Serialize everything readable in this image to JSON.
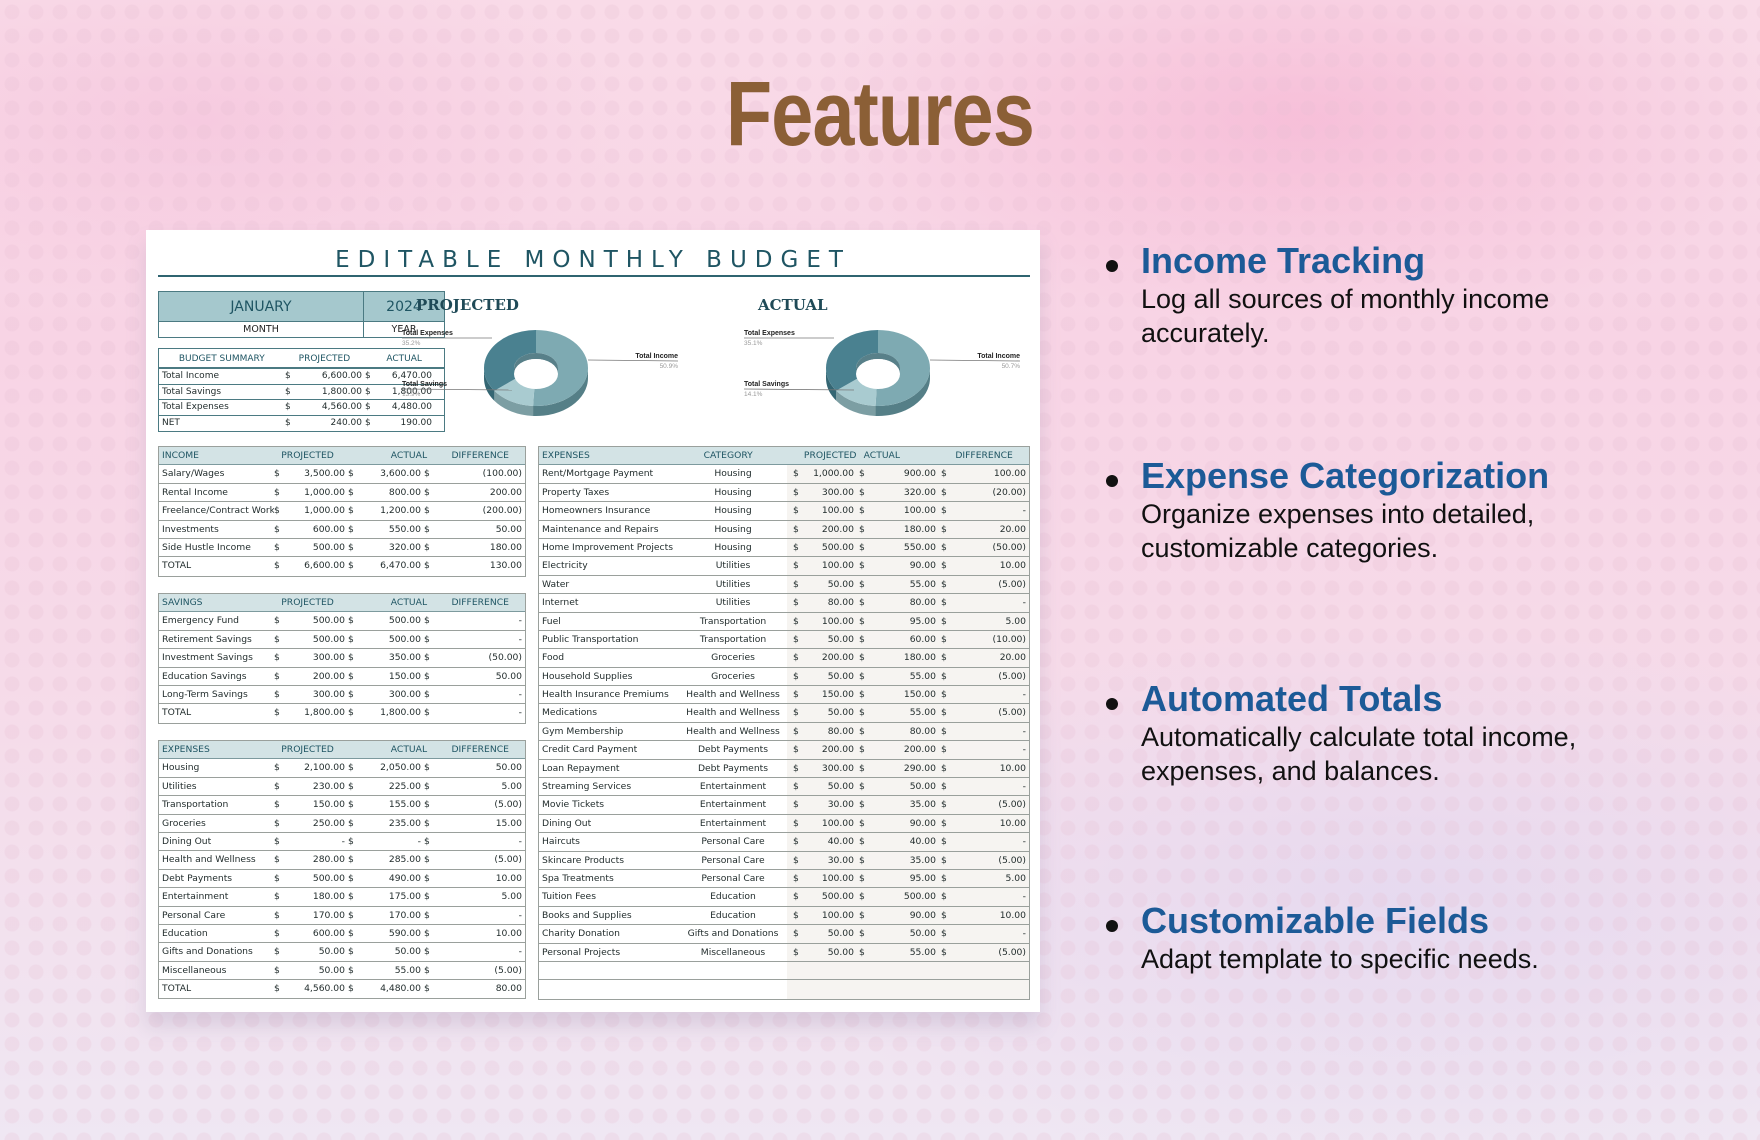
{
  "page": {
    "heading": "Features",
    "colors": {
      "heading": "#8b5f36",
      "feature_title": "#1c5a97",
      "sheet_accent": "#1f5563",
      "header_fill": "#a5c8cd"
    }
  },
  "sheet": {
    "title": "EDITABLE MONTHLY BUDGET",
    "month": {
      "value": "JANUARY",
      "label": "MONTH"
    },
    "year": {
      "value": "2024",
      "label": "YEAR"
    },
    "summary": {
      "headers": [
        "BUDGET SUMMARY",
        "PROJECTED",
        "ACTUAL"
      ],
      "rows": [
        {
          "label": "Total Income",
          "projected": "6,600.00",
          "actual": "6,470.00"
        },
        {
          "label": "Total Savings",
          "projected": "1,800.00",
          "actual": "1,800.00"
        },
        {
          "label": "Total Expenses",
          "projected": "4,560.00",
          "actual": "4,480.00"
        },
        {
          "label": "NET",
          "projected": "240.00",
          "actual": "190.00"
        }
      ]
    },
    "currency": "$",
    "income": {
      "headers": [
        "INCOME",
        "PROJECTED",
        "ACTUAL",
        "DIFFERENCE"
      ],
      "rows": [
        {
          "name": "Salary/Wages",
          "projected": "3,500.00",
          "actual": "3,600.00",
          "difference": "(100.00)"
        },
        {
          "name": "Rental Income",
          "projected": "1,000.00",
          "actual": "800.00",
          "difference": "200.00"
        },
        {
          "name": "Freelance/Contract Work",
          "projected": "1,000.00",
          "actual": "1,200.00",
          "difference": "(200.00)"
        },
        {
          "name": "Investments",
          "projected": "600.00",
          "actual": "550.00",
          "difference": "50.00"
        },
        {
          "name": "Side Hustle Income",
          "projected": "500.00",
          "actual": "320.00",
          "difference": "180.00"
        },
        {
          "name": "TOTAL",
          "projected": "6,600.00",
          "actual": "6,470.00",
          "difference": "130.00"
        }
      ]
    },
    "savings": {
      "headers": [
        "SAVINGS",
        "PROJECTED",
        "ACTUAL",
        "DIFFERENCE"
      ],
      "rows": [
        {
          "name": "Emergency Fund",
          "projected": "500.00",
          "actual": "500.00",
          "difference": "-"
        },
        {
          "name": "Retirement Savings",
          "projected": "500.00",
          "actual": "500.00",
          "difference": "-"
        },
        {
          "name": "Investment Savings",
          "projected": "300.00",
          "actual": "350.00",
          "difference": "(50.00)"
        },
        {
          "name": "Education Savings",
          "projected": "200.00",
          "actual": "150.00",
          "difference": "50.00"
        },
        {
          "name": "Long-Term Savings",
          "projected": "300.00",
          "actual": "300.00",
          "difference": "-"
        },
        {
          "name": "TOTAL",
          "projected": "1,800.00",
          "actual": "1,800.00",
          "difference": "-"
        }
      ]
    },
    "expenses_summary": {
      "headers": [
        "EXPENSES",
        "PROJECTED",
        "ACTUAL",
        "DIFFERENCE"
      ],
      "rows": [
        {
          "name": "Housing",
          "projected": "2,100.00",
          "actual": "2,050.00",
          "difference": "50.00"
        },
        {
          "name": "Utilities",
          "projected": "230.00",
          "actual": "225.00",
          "difference": "5.00"
        },
        {
          "name": "Transportation",
          "projected": "150.00",
          "actual": "155.00",
          "difference": "(5.00)"
        },
        {
          "name": "Groceries",
          "projected": "250.00",
          "actual": "235.00",
          "difference": "15.00"
        },
        {
          "name": "Dining Out",
          "projected": "-",
          "actual": "-",
          "difference": "-"
        },
        {
          "name": "Health and Wellness",
          "projected": "280.00",
          "actual": "285.00",
          "difference": "(5.00)"
        },
        {
          "name": "Debt Payments",
          "projected": "500.00",
          "actual": "490.00",
          "difference": "10.00"
        },
        {
          "name": "Entertainment",
          "projected": "180.00",
          "actual": "175.00",
          "difference": "5.00"
        },
        {
          "name": "Personal Care",
          "projected": "170.00",
          "actual": "170.00",
          "difference": "-"
        },
        {
          "name": "Education",
          "projected": "600.00",
          "actual": "590.00",
          "difference": "10.00"
        },
        {
          "name": "Gifts and Donations",
          "projected": "50.00",
          "actual": "50.00",
          "difference": "-"
        },
        {
          "name": "Miscellaneous",
          "projected": "50.00",
          "actual": "55.00",
          "difference": "(5.00)"
        },
        {
          "name": "TOTAL",
          "projected": "4,560.00",
          "actual": "4,480.00",
          "difference": "80.00"
        }
      ]
    },
    "expenses_detail": {
      "headers": [
        "EXPENSES",
        "CATEGORY",
        "PROJECTED",
        "ACTUAL",
        "DIFFERENCE"
      ],
      "rows": [
        {
          "name": "Rent/Mortgage Payment",
          "category": "Housing",
          "projected": "1,000.00",
          "actual": "900.00",
          "difference": "100.00"
        },
        {
          "name": "Property Taxes",
          "category": "Housing",
          "projected": "300.00",
          "actual": "320.00",
          "difference": "(20.00)"
        },
        {
          "name": "Homeowners Insurance",
          "category": "Housing",
          "projected": "100.00",
          "actual": "100.00",
          "difference": "-"
        },
        {
          "name": "Maintenance and Repairs",
          "category": "Housing",
          "projected": "200.00",
          "actual": "180.00",
          "difference": "20.00"
        },
        {
          "name": "Home Improvement Projects",
          "category": "Housing",
          "projected": "500.00",
          "actual": "550.00",
          "difference": "(50.00)"
        },
        {
          "name": "Electricity",
          "category": "Utilities",
          "projected": "100.00",
          "actual": "90.00",
          "difference": "10.00"
        },
        {
          "name": "Water",
          "category": "Utilities",
          "projected": "50.00",
          "actual": "55.00",
          "difference": "(5.00)"
        },
        {
          "name": "Internet",
          "category": "Utilities",
          "projected": "80.00",
          "actual": "80.00",
          "difference": "-"
        },
        {
          "name": "Fuel",
          "category": "Transportation",
          "projected": "100.00",
          "actual": "95.00",
          "difference": "5.00"
        },
        {
          "name": "Public Transportation",
          "category": "Transportation",
          "projected": "50.00",
          "actual": "60.00",
          "difference": "(10.00)"
        },
        {
          "name": "Food",
          "category": "Groceries",
          "projected": "200.00",
          "actual": "180.00",
          "difference": "20.00"
        },
        {
          "name": "Household Supplies",
          "category": "Groceries",
          "projected": "50.00",
          "actual": "55.00",
          "difference": "(5.00)"
        },
        {
          "name": "Health Insurance Premiums",
          "category": "Health and Wellness",
          "projected": "150.00",
          "actual": "150.00",
          "difference": "-"
        },
        {
          "name": "Medications",
          "category": "Health and Wellness",
          "projected": "50.00",
          "actual": "55.00",
          "difference": "(5.00)"
        },
        {
          "name": "Gym Membership",
          "category": "Health and Wellness",
          "projected": "80.00",
          "actual": "80.00",
          "difference": "-"
        },
        {
          "name": "Credit Card Payment",
          "category": "Debt Payments",
          "projected": "200.00",
          "actual": "200.00",
          "difference": "-"
        },
        {
          "name": "Loan Repayment",
          "category": "Debt Payments",
          "projected": "300.00",
          "actual": "290.00",
          "difference": "10.00"
        },
        {
          "name": "Streaming Services",
          "category": "Entertainment",
          "projected": "50.00",
          "actual": "50.00",
          "difference": "-"
        },
        {
          "name": "Movie Tickets",
          "category": "Entertainment",
          "projected": "30.00",
          "actual": "35.00",
          "difference": "(5.00)"
        },
        {
          "name": "Dining Out",
          "category": "Entertainment",
          "projected": "100.00",
          "actual": "90.00",
          "difference": "10.00"
        },
        {
          "name": "Haircuts",
          "category": "Personal Care",
          "projected": "40.00",
          "actual": "40.00",
          "difference": "-"
        },
        {
          "name": "Skincare Products",
          "category": "Personal Care",
          "projected": "30.00",
          "actual": "35.00",
          "difference": "(5.00)"
        },
        {
          "name": "Spa Treatments",
          "category": "Personal Care",
          "projected": "100.00",
          "actual": "95.00",
          "difference": "5.00"
        },
        {
          "name": "Tuition Fees",
          "category": "Education",
          "projected": "500.00",
          "actual": "500.00",
          "difference": "-"
        },
        {
          "name": "Books and Supplies",
          "category": "Education",
          "projected": "100.00",
          "actual": "90.00",
          "difference": "10.00"
        },
        {
          "name": "Charity Donation",
          "category": "Gifts and Donations",
          "projected": "50.00",
          "actual": "50.00",
          "difference": "-"
        },
        {
          "name": "Personal Projects",
          "category": "Miscellaneous",
          "projected": "50.00",
          "actual": "55.00",
          "difference": "(5.00)"
        }
      ],
      "empty_rows": 2
    }
  },
  "chart_data": [
    {
      "type": "pie",
      "title": "PROJECTED",
      "categories": [
        "Total Income",
        "Total Expenses",
        "Total Savings"
      ],
      "values": [
        50.9,
        35.2,
        13.9
      ],
      "labels": [
        "50.9%",
        "35.2%",
        "13.9%"
      ],
      "colors": [
        "#7eaab2",
        "#4a8190",
        "#a9cbd0"
      ],
      "style": "3d-donut"
    },
    {
      "type": "pie",
      "title": "ACTUAL",
      "categories": [
        "Total Income",
        "Total Expenses",
        "Total Savings"
      ],
      "values": [
        50.7,
        35.1,
        14.1
      ],
      "labels": [
        "50.7%",
        "35.1%",
        "14.1%"
      ],
      "colors": [
        "#7eaab2",
        "#4a8190",
        "#a9cbd0"
      ],
      "style": "3d-donut"
    }
  ],
  "features": [
    {
      "title": "Income Tracking",
      "description": "Log all sources of monthly income accurately."
    },
    {
      "title": "Expense Categorization",
      "description": "Organize expenses into detailed, customizable categories."
    },
    {
      "title": "Automated Totals",
      "description": "Automatically calculate total income, expenses, and balances."
    },
    {
      "title": "Customizable Fields",
      "description": "Adapt template to specific needs."
    }
  ]
}
